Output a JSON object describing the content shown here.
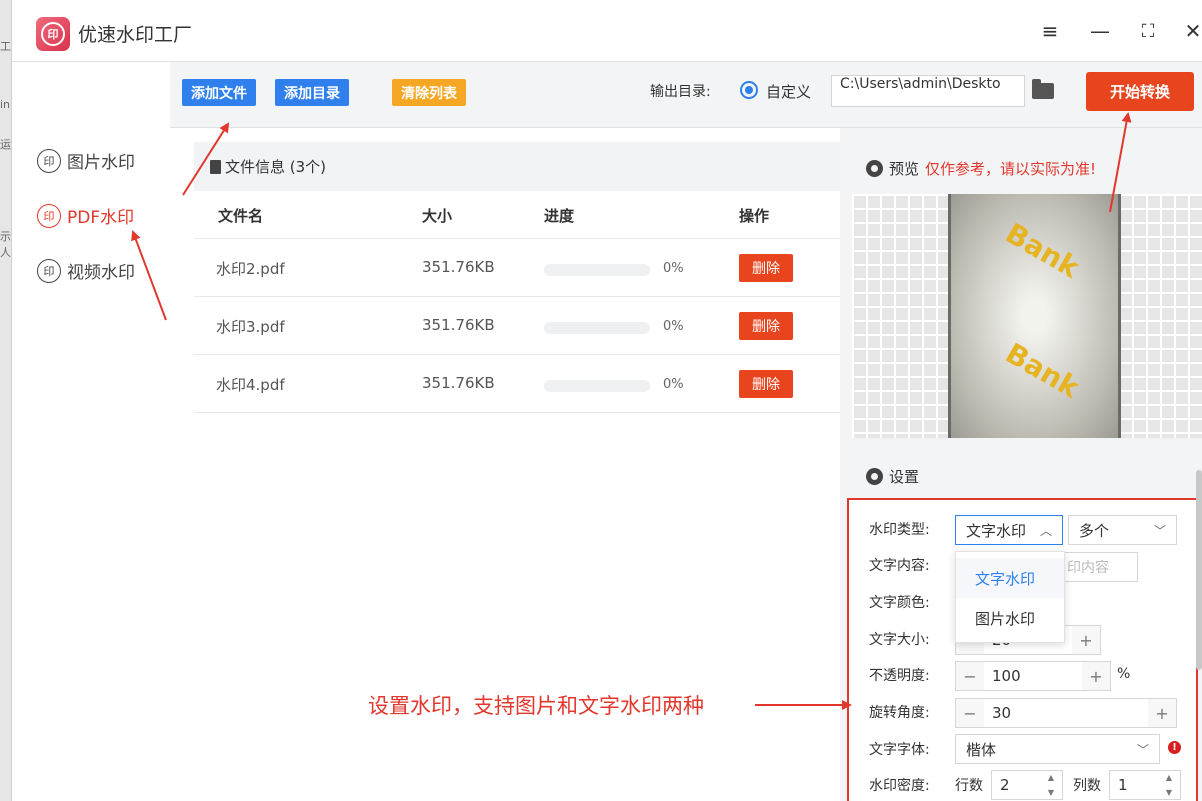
{
  "behind_window": {
    "fragments": [
      "工",
      "in",
      "运",
      "示人"
    ]
  },
  "app": {
    "logo_text": "印",
    "title": "优速水印工厂"
  },
  "window_controls": {
    "menu": "≡",
    "minimize": "—",
    "maximize": "⛶",
    "close": "✕"
  },
  "sidebar": {
    "items": [
      {
        "label": "图片水印",
        "icon": "印"
      },
      {
        "label": "PDF水印",
        "icon": "印"
      },
      {
        "label": "视频水印",
        "icon": "印"
      }
    ]
  },
  "toolbar": {
    "add_file": "添加文件",
    "add_dir": "添加目录",
    "clear_list": "清除列表",
    "output_label": "输出目录:",
    "custom_label": "自定义",
    "output_path": "C:\\Users\\admin\\Deskto",
    "start_button": "开始转换"
  },
  "colors": {
    "primary": "#2f80ed",
    "orange": "#f5a623",
    "danger": "#e8451f",
    "accent_red": "#e2372c"
  },
  "file_panel": {
    "header": "文件信息 (3个)",
    "columns": [
      "文件名",
      "大小",
      "进度",
      "操作"
    ],
    "rows": [
      {
        "name": "水印2.pdf",
        "size": "351.76KB",
        "progress": "0%",
        "action": "删除"
      },
      {
        "name": "水印3.pdf",
        "size": "351.76KB",
        "progress": "0%",
        "action": "删除"
      },
      {
        "name": "水印4.pdf",
        "size": "351.76KB",
        "progress": "0%",
        "action": "删除"
      }
    ]
  },
  "preview": {
    "title": "预览",
    "note": "仅作参考，请以实际为准!",
    "watermark_text": "Bank"
  },
  "settings": {
    "title": "设置",
    "watermark_type_label": "水印类型:",
    "watermark_type_value": "文字水印",
    "count_value": "多个",
    "text_content_label": "文字内容:",
    "text_content_placeholder": "印内容",
    "text_color_label": "文字颜色:",
    "text_size_label": "文字大小:",
    "text_size_value": "20",
    "opacity_label": "不透明度:",
    "opacity_value": "100",
    "opacity_unit": "%",
    "rotation_label": "旋转角度:",
    "rotation_value": "30",
    "font_label": "文字字体:",
    "font_value": "楷体",
    "density_label": "水印密度:",
    "rows_label": "行数",
    "rows_value": "2",
    "cols_label": "列数",
    "cols_value": "1",
    "dropdown_options": [
      "文字水印",
      "图片水印"
    ]
  },
  "annotation": {
    "text": "设置水印，支持图片和文字水印两种"
  }
}
